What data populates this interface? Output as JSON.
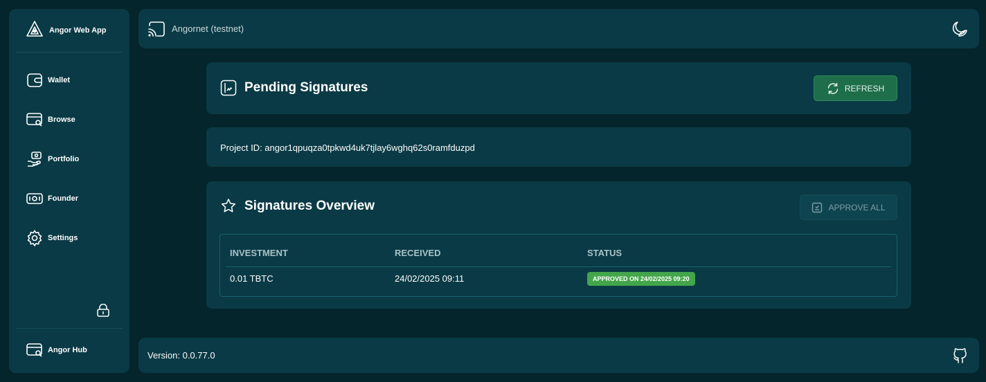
{
  "sidebar": {
    "brand": "Angor Web App",
    "items": [
      {
        "label": "Wallet",
        "icon": "wallet-icon"
      },
      {
        "label": "Browse",
        "icon": "browse-icon"
      },
      {
        "label": "Portfolio",
        "icon": "portfolio-icon"
      },
      {
        "label": "Founder",
        "icon": "founder-icon"
      },
      {
        "label": "Settings",
        "icon": "gear-icon"
      }
    ],
    "hub": "Angor Hub"
  },
  "header": {
    "network": "Angornet (testnet)"
  },
  "pending": {
    "title": "Pending Signatures",
    "refresh_label": "REFRESH"
  },
  "project": {
    "id_text": "Project ID: angor1qpuqza0tpkwd4uk7tjlay6wghq62s0ramfduzpd"
  },
  "overview": {
    "title": "Signatures Overview",
    "approve_all_label": "APPROVE ALL",
    "columns": [
      "INVESTMENT",
      "RECEIVED",
      "STATUS"
    ],
    "rows": [
      {
        "investment": "0.01 TBTC",
        "received": "24/02/2025 09:11",
        "status": "APPROVED ON 24/02/2025 09:20"
      }
    ]
  },
  "footer": {
    "version": "Version: 0.0.77.0"
  },
  "colors": {
    "background": "#04252b",
    "panel": "#0a3a45",
    "refresh_button": "#1f6e4a",
    "status_badge": "#43a64a"
  }
}
